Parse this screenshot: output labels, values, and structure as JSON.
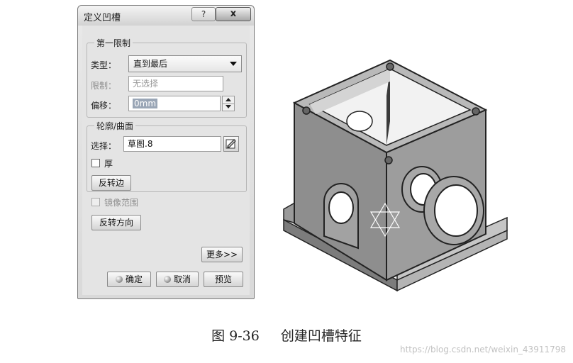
{
  "dialog": {
    "title": "定义凹槽",
    "help_label": "?",
    "close_label": "x",
    "first_limit": {
      "legend": "第一限制",
      "type_label": "类型：",
      "type_value": "直到最后",
      "limit_label": "限制：",
      "limit_placeholder": "无选择",
      "offset_label": "偏移：",
      "offset_value": "0mm"
    },
    "profile": {
      "legend": "轮廓/曲面",
      "select_label": "选择：",
      "select_value": "草图.8",
      "thick_label": "厚",
      "reverse_side_label": "反转边"
    },
    "mirror_label": "镜像范围",
    "reverse_direction_label": "反转方向",
    "more_label": "更多>>",
    "ok_label": "确定",
    "cancel_label": "取消",
    "preview_label": "预览"
  },
  "caption": {
    "figure_number": "图 9-36",
    "text": "创建凹槽特征"
  },
  "watermark": "https://blog.csdn.net/weixin_43911798"
}
